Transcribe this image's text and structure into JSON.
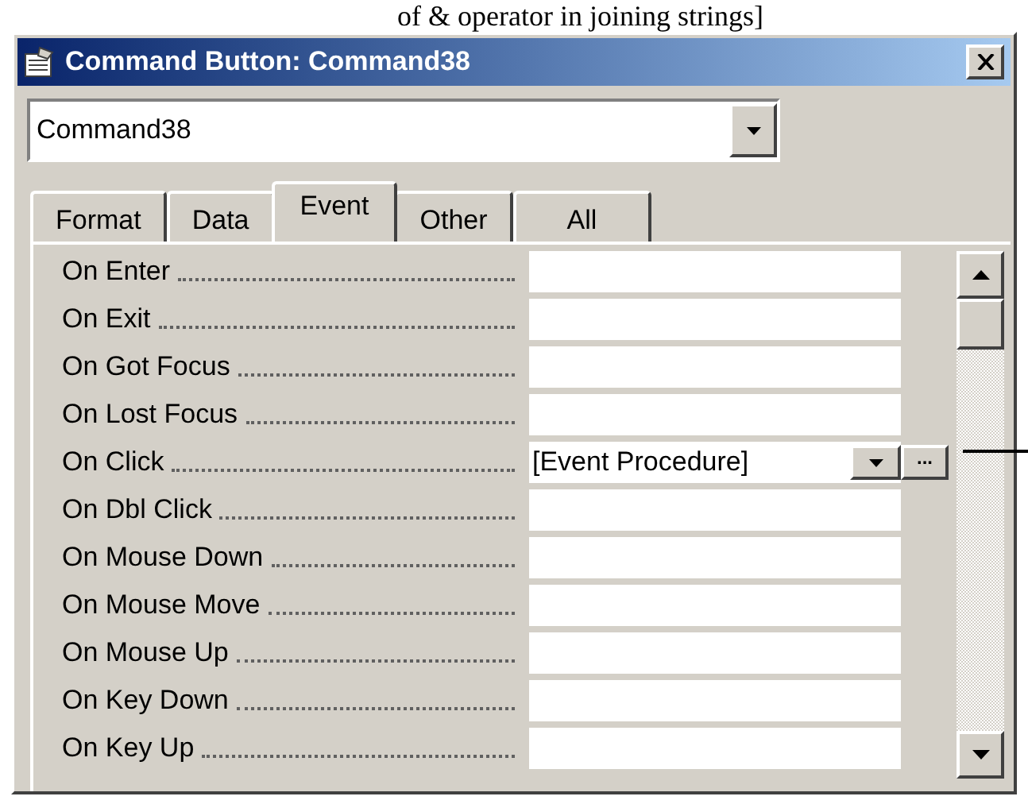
{
  "caption": "of & operator in joining strings]",
  "window": {
    "title": "Command Button: Command38"
  },
  "object_selector": {
    "value": "Command38"
  },
  "tabs": [
    {
      "label": "Format",
      "selected": false
    },
    {
      "label": "Data",
      "selected": false
    },
    {
      "label": "Event",
      "selected": true
    },
    {
      "label": "Other",
      "selected": false
    },
    {
      "label": "All",
      "selected": false
    }
  ],
  "properties": [
    {
      "label": "On Enter",
      "active": false
    },
    {
      "label": "On Exit",
      "active": false
    },
    {
      "label": "On Got Focus",
      "active": false
    },
    {
      "label": "On Lost Focus",
      "active": false
    },
    {
      "label": "On Click",
      "value": "[Event Procedure]",
      "active": true
    },
    {
      "label": "On Dbl Click",
      "active": false
    },
    {
      "label": "On Mouse Down",
      "active": false
    },
    {
      "label": "On Mouse Move",
      "active": false
    },
    {
      "label": "On Mouse Up",
      "active": false
    },
    {
      "label": "On Key Down",
      "active": false
    },
    {
      "label": "On Key Up",
      "active": false
    }
  ],
  "builder_button": "..."
}
